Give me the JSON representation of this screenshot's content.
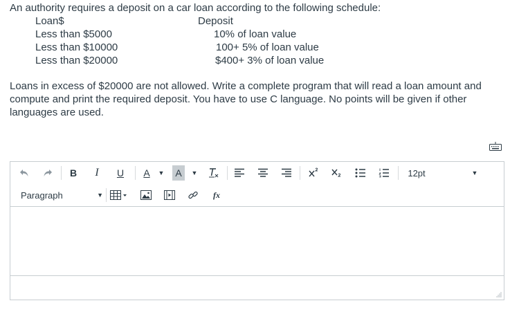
{
  "question": {
    "intro": "An authority requires a deposit on a car loan according to the following schedule:",
    "schedule_header": {
      "loan": "Loan$",
      "deposit": "Deposit"
    },
    "schedule_rows": [
      {
        "loan": "Less than $5000",
        "deposit": "10% of loan value"
      },
      {
        "loan": "Less than $10000",
        "deposit": "100+ 5% of loan value"
      },
      {
        "loan": "Less than $20000",
        "deposit": "$400+ 3% of loan value"
      }
    ],
    "body": "Loans in excess of $20000 are not allowed. Write a complete program that will read a loan amount and compute and print the required deposit. You have to use C language. No points will be given if other languages are used."
  },
  "editor": {
    "toolbar": {
      "bold_label": "B",
      "italic_label": "I",
      "underline_label": "U",
      "font_color_label": "A",
      "bg_color_label": "A",
      "font_size_label": "12pt",
      "block_format_label": "Paragraph",
      "equation_label": "fx"
    },
    "content": ""
  },
  "colors": {
    "text": "#2d3b45",
    "border": "#c7cdd1",
    "icon_gray": "#8b969e"
  }
}
